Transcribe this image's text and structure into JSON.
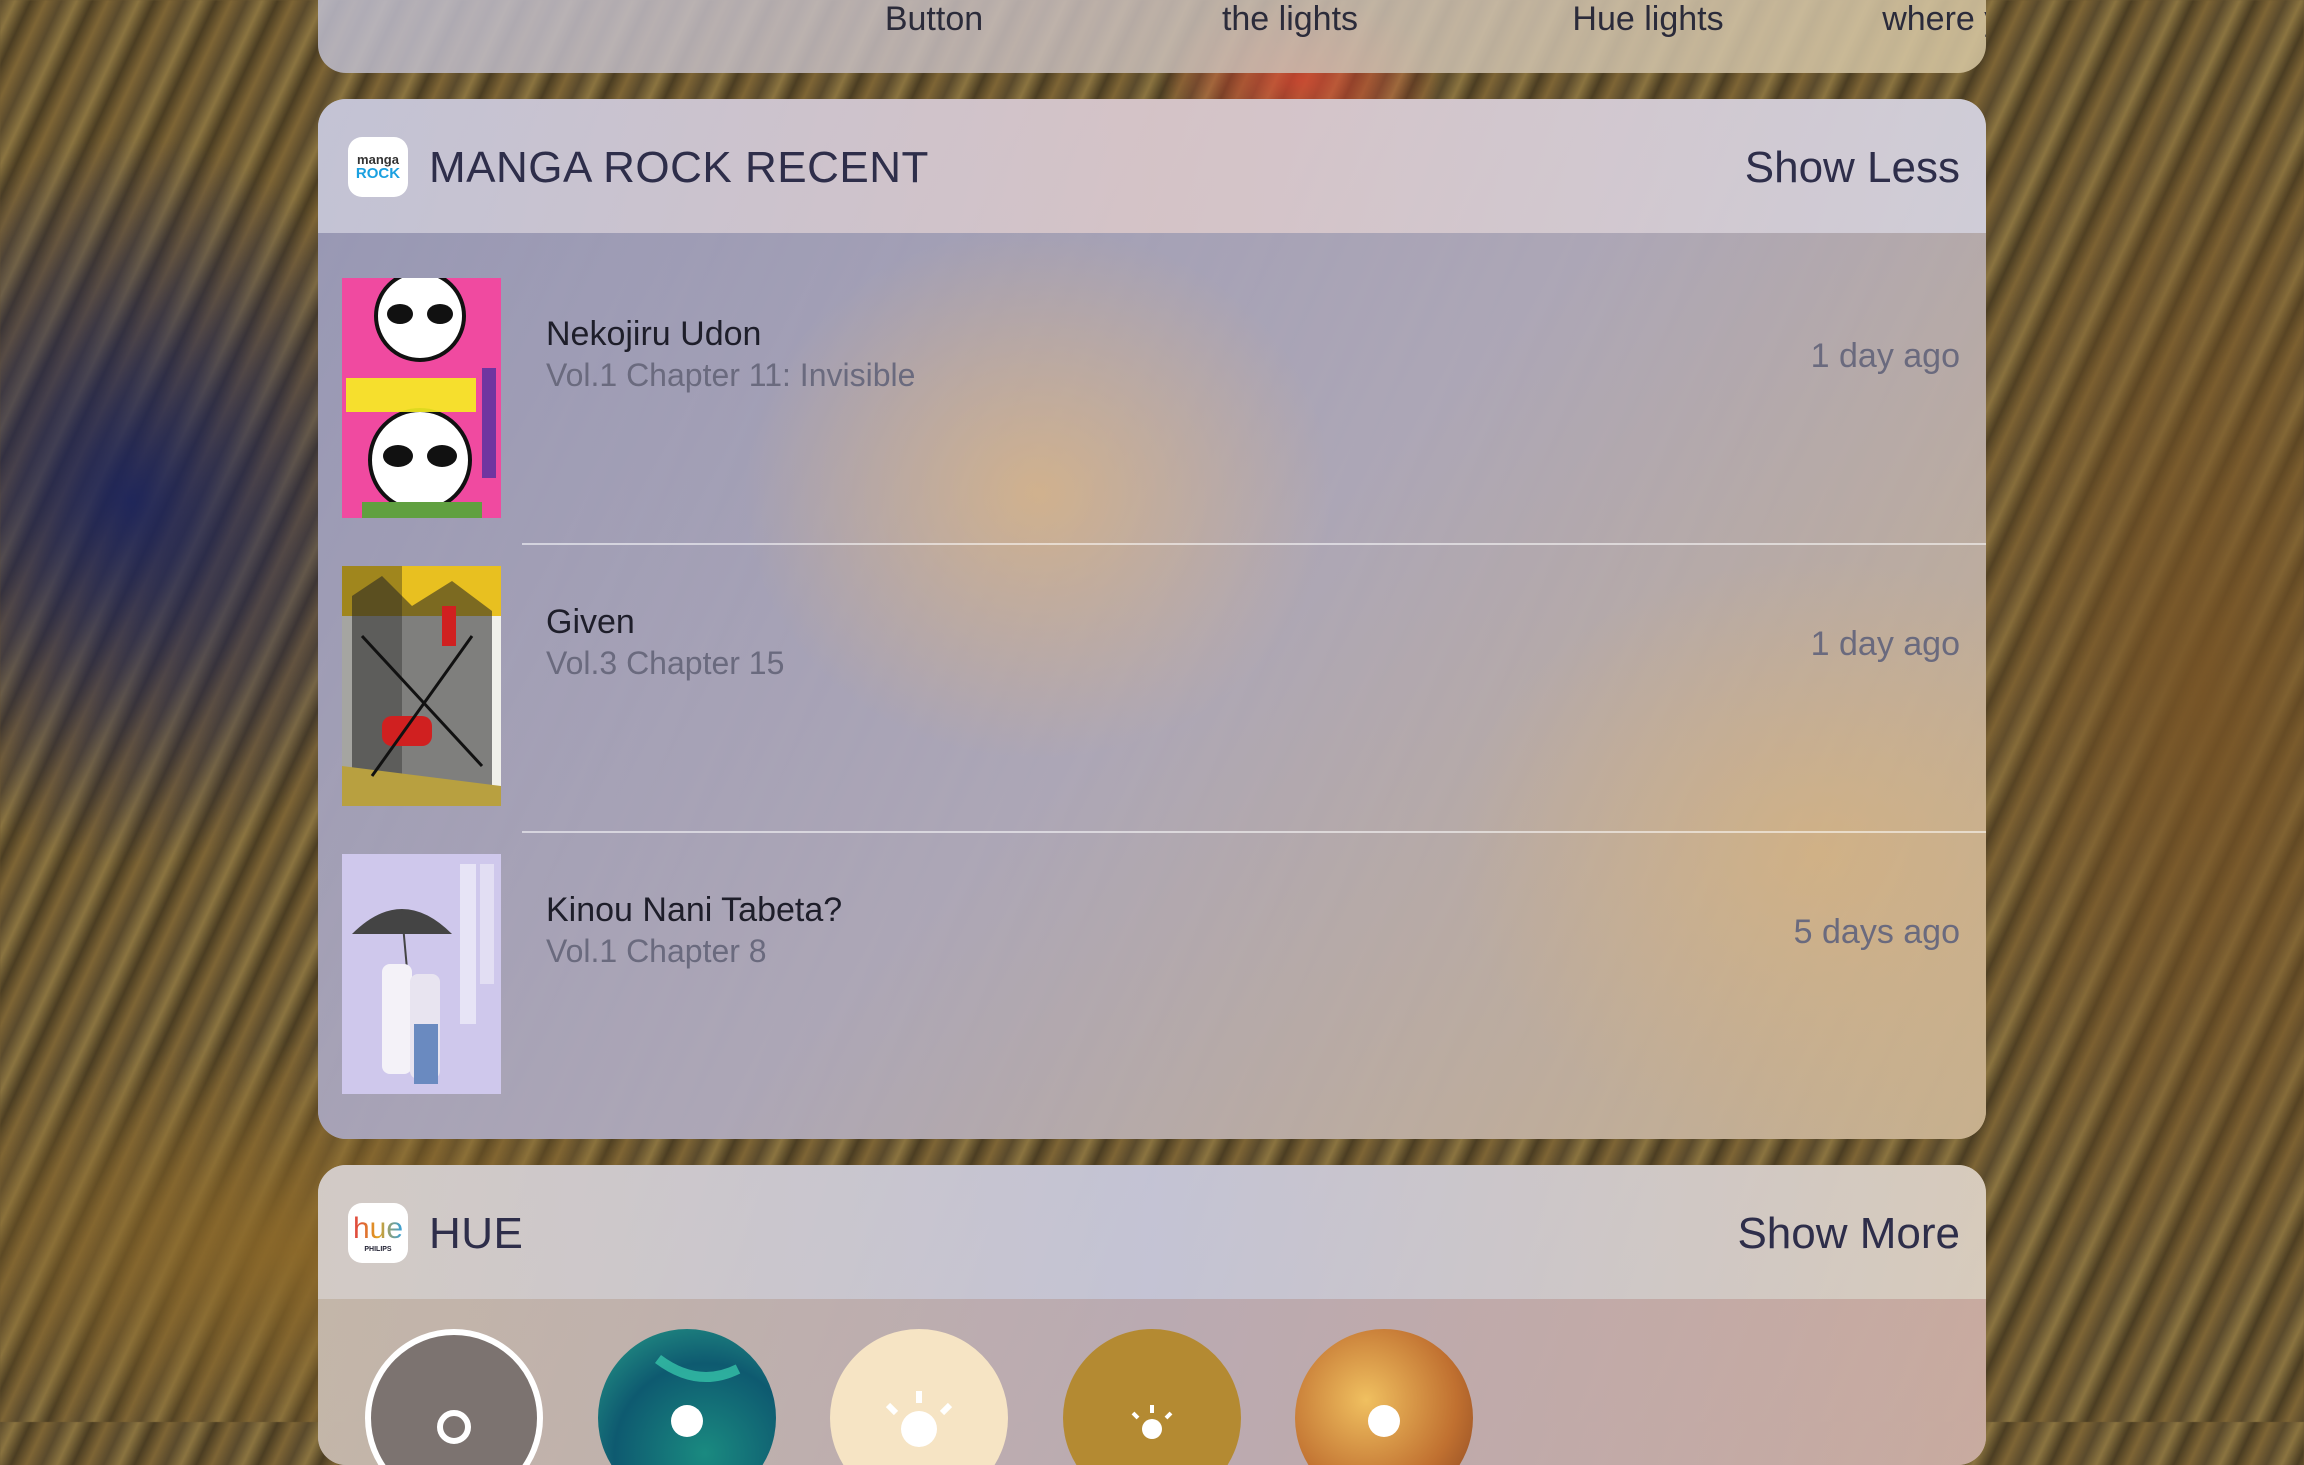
{
  "previous_widget": {
    "labels": [
      "Button",
      "the lights",
      "Hue lights",
      "where you wer..."
    ]
  },
  "manga_widget": {
    "title": "MANGA ROCK RECENT",
    "action": "Show Less",
    "icon": {
      "name": "manga-rock-app-icon",
      "text_top": "manga",
      "text_bottom": "ROCK"
    },
    "items": [
      {
        "title": "Nekojiru Udon",
        "subtitle": "Vol.1 Chapter 11: Invisible",
        "time": "1 day ago",
        "cover_colors": [
          "#f04aa0",
          "#ffffff"
        ]
      },
      {
        "title": "Given",
        "subtitle": "Vol.3 Chapter 15",
        "time": "1 day ago",
        "cover_colors": [
          "#e8c020",
          "#1a1a1a"
        ]
      },
      {
        "title": "Kinou Nani Tabeta?",
        "subtitle": "Vol.1 Chapter 8",
        "time": "5 days ago",
        "cover_colors": [
          "#c8c0e8",
          "#f4f2f8"
        ]
      }
    ]
  },
  "hue_widget": {
    "title": "HUE",
    "action": "Show More",
    "icon": {
      "name": "hue-app-icon",
      "text": "hue",
      "subtext": "PHILIPS"
    },
    "scenes": [
      {
        "name": "hue-scene-off",
        "icon": "lightbulb-icon"
      },
      {
        "name": "hue-scene-teal",
        "icon": "lightbulb-icon"
      },
      {
        "name": "hue-scene-bright",
        "icon": "sun-icon"
      },
      {
        "name": "hue-scene-dimmed",
        "icon": "sun-icon"
      },
      {
        "name": "hue-scene-warm",
        "icon": "lightbulb-icon"
      }
    ]
  }
}
